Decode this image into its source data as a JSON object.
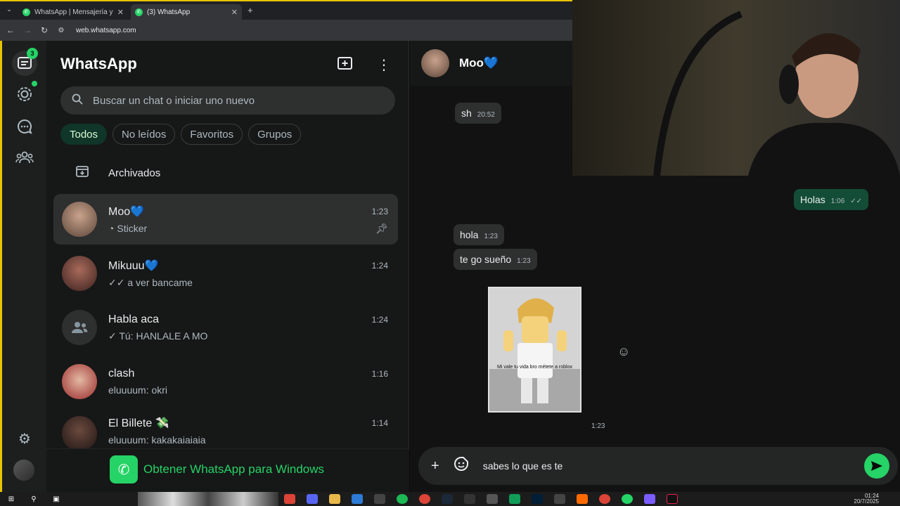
{
  "browser": {
    "tabs": [
      {
        "label": "WhatsApp | Mensajería y llamad"
      },
      {
        "label": "(3) WhatsApp"
      }
    ],
    "url": "web.whatsapp.com"
  },
  "rail": {
    "chats_badge": "3"
  },
  "list": {
    "title": "WhatsApp",
    "search_placeholder": "Buscar un chat o iniciar uno nuevo",
    "filters": [
      "Todos",
      "No leídos",
      "Favoritos",
      "Grupos"
    ],
    "archived_label": "Archivados",
    "chats": [
      {
        "name": "Moo💙",
        "time": "1:23",
        "prefix": "",
        "preview": "Sticker"
      },
      {
        "name": "Mikuuu💙",
        "time": "1:24",
        "prefix": "✓✓",
        "preview": "a ver bancame"
      },
      {
        "name": "Habla aca",
        "time": "1:24",
        "prefix": "✓",
        "preview": "Tú: HANLALE A MO"
      },
      {
        "name": "clash",
        "time": "1:16",
        "prefix": "",
        "preview": "eluuuum: okri"
      },
      {
        "name": "El Billete 💸",
        "time": "1:14",
        "prefix": "",
        "preview": "eluuuum: kakakaiaiaia"
      }
    ],
    "get_app": "Obtener WhatsApp para Windows"
  },
  "conversation": {
    "contact_name": "Moo💙",
    "messages": [
      {
        "text": "sh",
        "time": "20:52"
      },
      {
        "text": "Holas",
        "time": "1:06"
      },
      {
        "text": "hola",
        "time": "1:23"
      },
      {
        "text": "te go sueño",
        "time": "1:23"
      }
    ],
    "sticker_caption": "Mi vale tu vida bro métete a roblox",
    "sticker_time": "1:23",
    "composer_value": "sabes lo que es te"
  },
  "taskbar": {
    "time": "01:24",
    "date": "20/7/2025"
  },
  "colors": {
    "accent": "#25d366",
    "outgoing_bubble": "#144d37",
    "incoming_bubble": "#2e2f2f",
    "panel": "#161717"
  }
}
